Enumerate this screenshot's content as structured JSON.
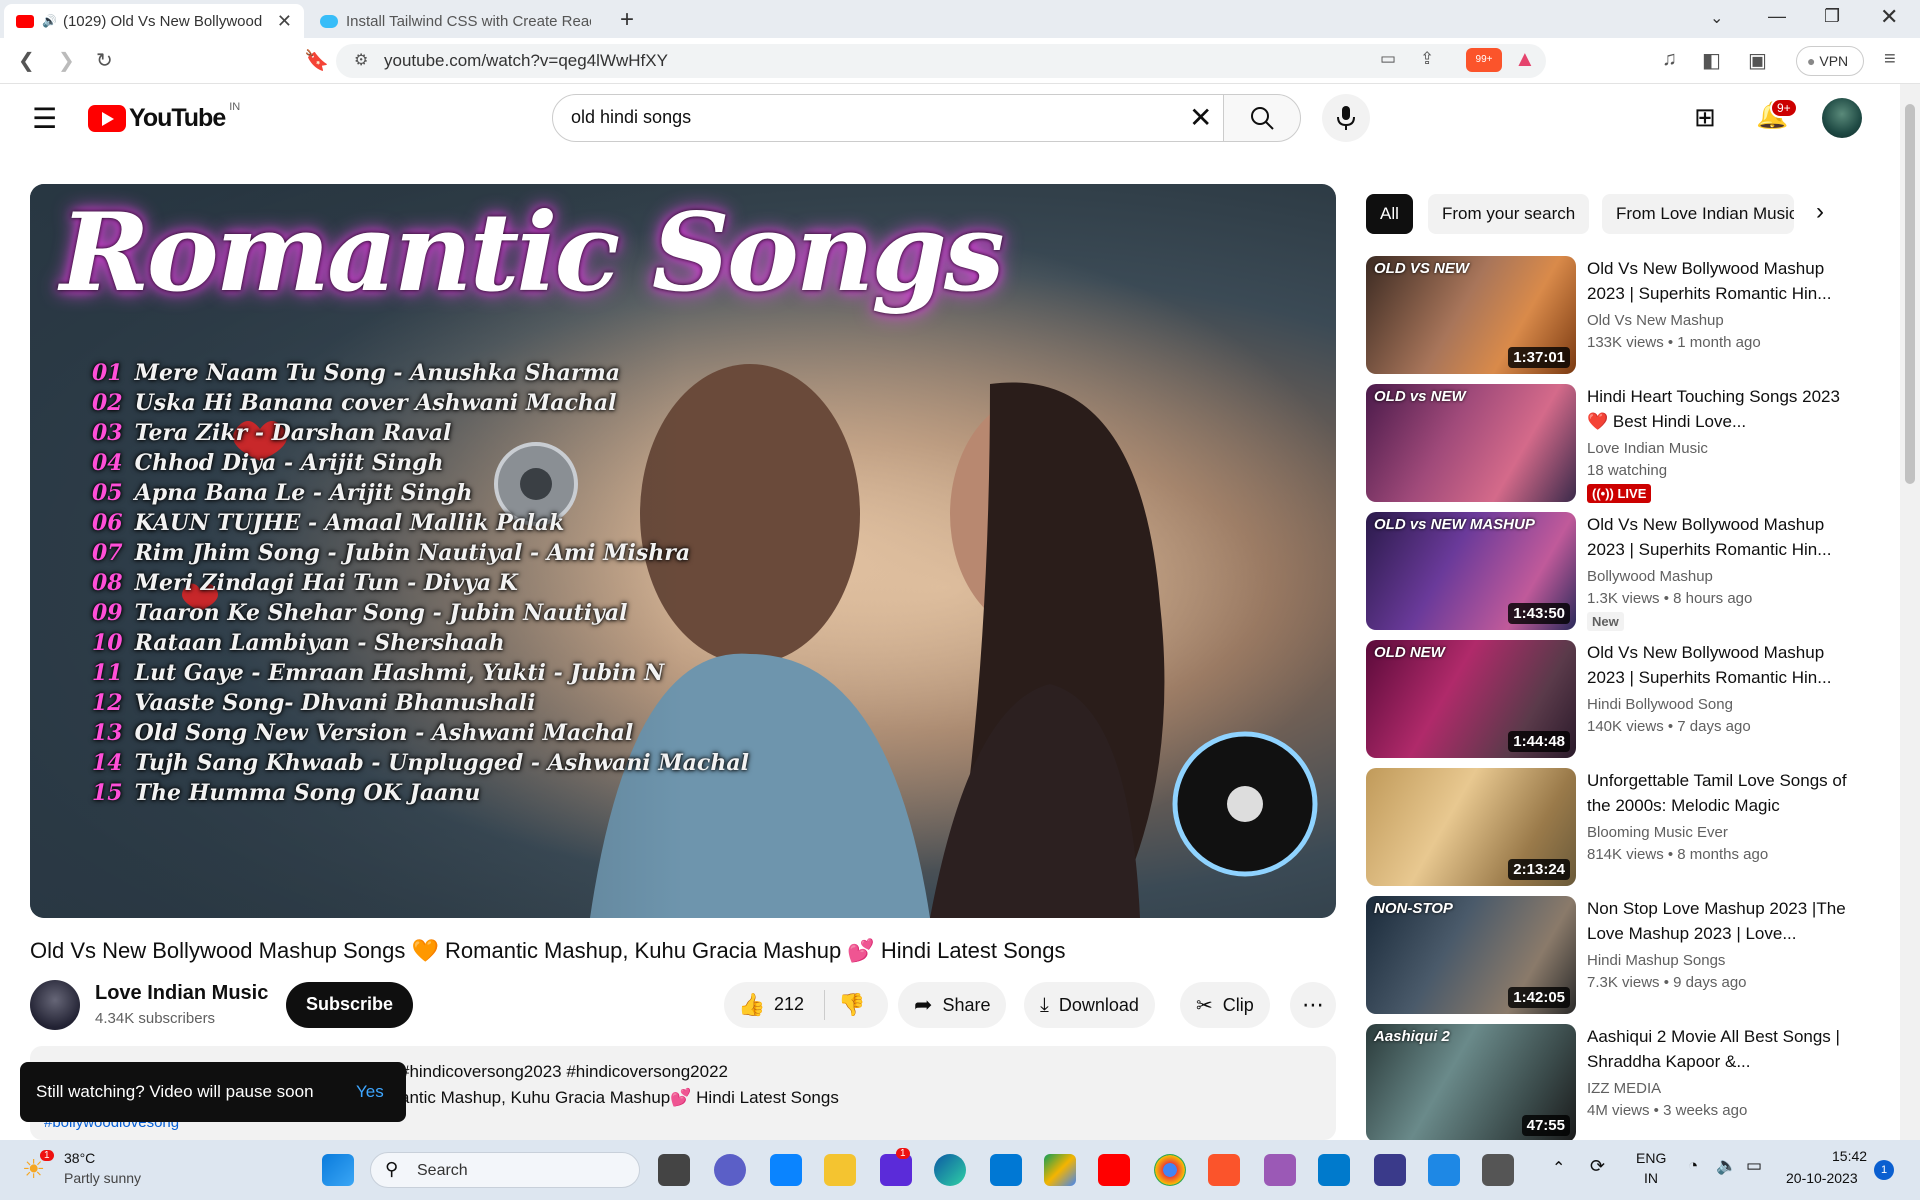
{
  "browser": {
    "tabs": [
      {
        "title": "(1029) Old Vs New Bollywood"
      },
      {
        "title": "Install Tailwind CSS with Create React"
      }
    ],
    "url": "youtube.com/watch?v=qeg4lWwHfXY",
    "vpn_label": "VPN",
    "brave_badge": "99+"
  },
  "youtube": {
    "logo_text": "YouTube",
    "country": "IN",
    "search_value": "old hindi songs",
    "notification_count": "9+"
  },
  "video": {
    "overlay_title": "Romantic Songs",
    "tracklist": [
      {
        "num": "01",
        "text": "Mere Naam Tu Song - Anushka Sharma"
      },
      {
        "num": "02",
        "text": "Uska Hi Banana cover Ashwani Machal"
      },
      {
        "num": "03",
        "text": "Tera Zikr - Darshan Raval"
      },
      {
        "num": "04",
        "text": "Chhod Diya - Arijit Singh"
      },
      {
        "num": "05",
        "text": "Apna Bana Le - Arijit Singh"
      },
      {
        "num": "06",
        "text": "KAUN TUJHE - Amaal Mallik Palak"
      },
      {
        "num": "07",
        "text": "Rim Jhim Song - Jubin Nautiyal - Ami Mishra"
      },
      {
        "num": "08",
        "text": "Meri Zindagi Hai Tun - Divya K"
      },
      {
        "num": "09",
        "text": "Taaron Ke Shehar Song - Jubin Nautiyal"
      },
      {
        "num": "10",
        "text": "Rataan Lambiyan - Shershaah"
      },
      {
        "num": "11",
        "text": "Lut Gaye - Emraan Hashmi, Yukti - Jubin N"
      },
      {
        "num": "12",
        "text": "Vaaste Song- Dhvani Bhanushali"
      },
      {
        "num": "13",
        "text": "Old Song New Version - Ashwani Machal"
      },
      {
        "num": "14",
        "text": "Tujh Sang Khwaab - Unplugged - Ashwani Machal"
      },
      {
        "num": "15",
        "text": "The Humma Song  OK Jaanu"
      }
    ],
    "title": "Old Vs New Bollywood Mashup Songs 🧡 Romantic Mashup, Kuhu Gracia Mashup 💕 Hindi Latest Songs",
    "channel": "Love Indian Music",
    "subscribers": "4.34K subscribers",
    "subscribe_label": "Subscribe",
    "likes": "212",
    "share_label": "Share",
    "download_label": "Download",
    "clip_label": "Clip",
    "description_line1": "#hindicoversong2023 #hindicoversong2022",
    "description_line2": "antic Mashup, Kuhu Gracia Mashup💕 Hindi Latest Songs",
    "description_tag": "#bollywoodlovesong"
  },
  "toast": {
    "message": "Still watching? Video will pause soon",
    "action": "Yes"
  },
  "chips": [
    "All",
    "From your search",
    "From Love Indian Music"
  ],
  "recommendations": [
    {
      "title": "Old Vs New Bollywood Mashup 2023 | Superhits Romantic Hin...",
      "channel": "Old Vs New Mashup",
      "meta": "133K views  • 1 month ago",
      "duration": "1:37:01",
      "thumb_text": "OLD VS NEW",
      "badge": ""
    },
    {
      "title": "Hindi Heart Touching Songs 2023❤️ Best Hindi Love...",
      "channel": "Love Indian Music",
      "meta": "18 watching",
      "duration": "",
      "thumb_text": "OLD vs NEW",
      "badge": "LIVE"
    },
    {
      "title": "Old Vs New Bollywood Mashup 2023 | Superhits Romantic Hin...",
      "channel": "Bollywood Mashup",
      "meta": "1.3K views  • 8 hours ago",
      "duration": "1:43:50",
      "thumb_text": "OLD vs NEW MASHUP",
      "badge": "New"
    },
    {
      "title": "Old Vs New Bollywood Mashup 2023 | Superhits Romantic Hin...",
      "channel": "Hindi Bollywood Song",
      "meta": "140K views  • 7 days ago",
      "duration": "1:44:48",
      "thumb_text": "OLD NEW",
      "badge": ""
    },
    {
      "title": "Unforgettable Tamil Love Songs of the 2000s: Melodic Magic",
      "channel": "Blooming Music Ever",
      "meta": "814K views  • 8 months ago",
      "duration": "2:13:24",
      "thumb_text": "",
      "badge": ""
    },
    {
      "title": "Non Stop Love Mashup 2023 |The Love Mashup 2023 | Love...",
      "channel": "Hindi Mashup Songs",
      "meta": "7.3K views  • 9 days ago",
      "duration": "1:42:05",
      "thumb_text": "NON-STOP",
      "badge": ""
    },
    {
      "title": "Aashiqui 2 Movie All Best Songs | Shraddha Kapoor &...",
      "channel": "IZZ MEDIA",
      "meta": "4M views  • 3 weeks ago",
      "duration": "47:55",
      "thumb_text": "Aashiqui 2",
      "badge": ""
    }
  ],
  "taskbar": {
    "weather_temp": "38°C",
    "weather_desc": "Partly sunny",
    "weather_badge": "1",
    "search_label": "Search",
    "lang_line1": "ENG",
    "lang_line2": "IN",
    "time": "15:42",
    "date": "20-10-2023",
    "notif_count": "1",
    "app_badge": "1"
  },
  "colors": {
    "yt_red": "#ff0000",
    "chip_active_bg": "#0f0f0f",
    "live_red": "#cc0000",
    "taskbar_bg": "#dde6f0"
  }
}
